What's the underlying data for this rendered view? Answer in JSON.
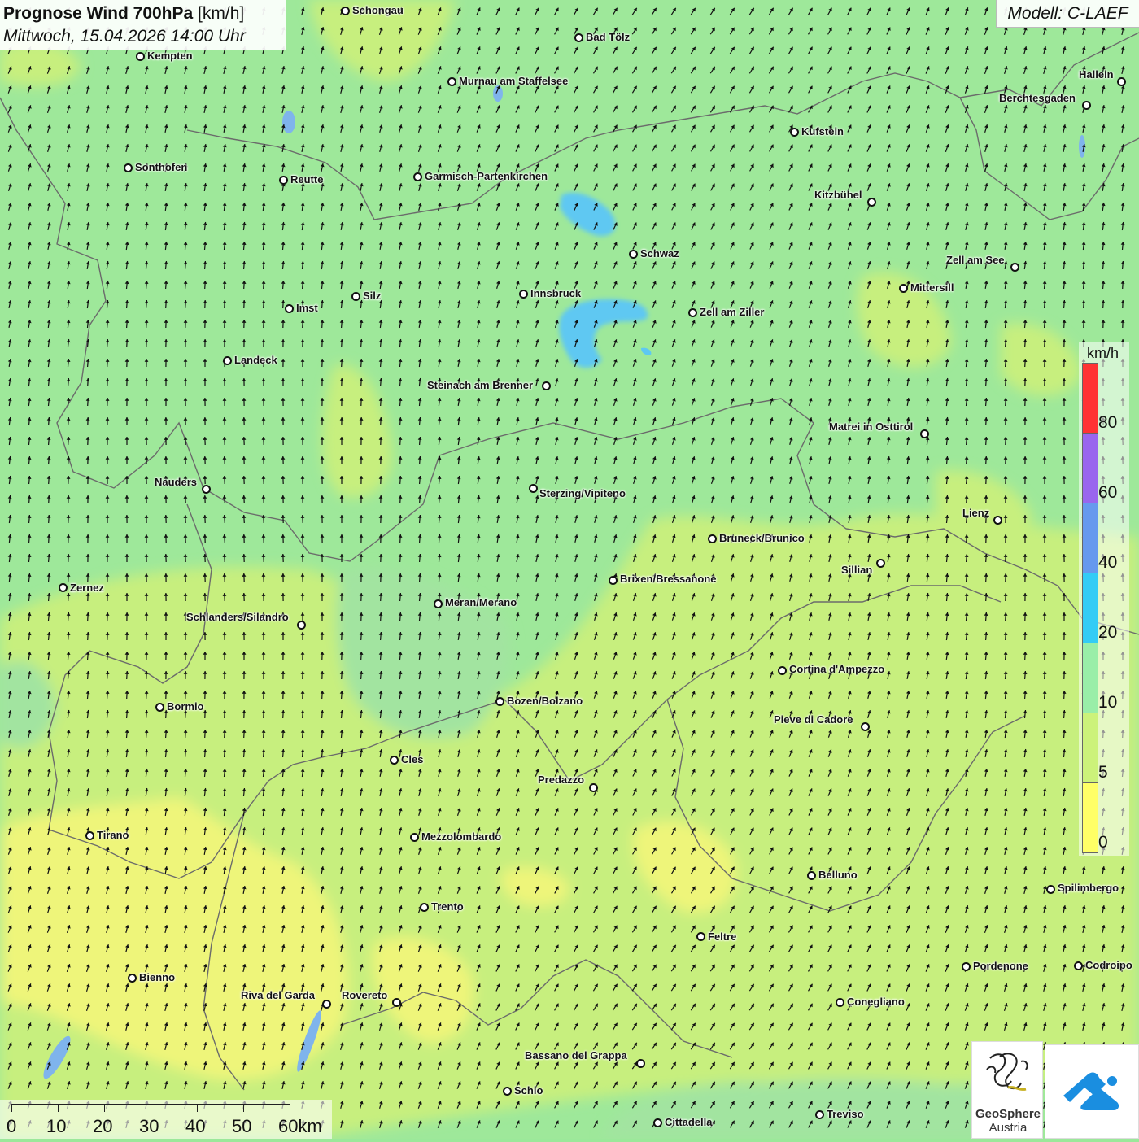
{
  "header": {
    "title": "Prognose Wind 700hPa",
    "title_unit": "[km/h]",
    "datetime": "Mittwoch, 15.04.2026 14:00 Uhr",
    "model": "Modell: C-LAEF"
  },
  "legend": {
    "unit": "km/h",
    "classes": [
      {
        "color": "#ff3333",
        "label": ""
      },
      {
        "color": "#9966ee",
        "label": "80"
      },
      {
        "color": "#6699ee",
        "label": "60"
      },
      {
        "color": "#33ccf5",
        "label": "40"
      },
      {
        "color": "#99eea8",
        "label": "20"
      },
      {
        "color": "#ccf27a",
        "label": "10"
      },
      {
        "color": "#ffff66",
        "label": "5"
      }
    ],
    "bottom_label": "0"
  },
  "scale_bar": {
    "labels": [
      "0",
      "10",
      "20",
      "30",
      "40",
      "50",
      "60km"
    ]
  },
  "wind": {
    "general_direction": "south-southwest",
    "max_speed_class": "20-40 km/h near Innsbruck"
  },
  "cities": [
    {
      "name": "Schongau"
    },
    {
      "name": "Bad Tölz"
    },
    {
      "name": "Kempten"
    },
    {
      "name": "Murnau am Staffelsee"
    },
    {
      "name": "Hallein"
    },
    {
      "name": "Berchtesgaden"
    },
    {
      "name": "Kufstein"
    },
    {
      "name": "Sonthofen"
    },
    {
      "name": "Reutte"
    },
    {
      "name": "Garmisch-Partenkirchen"
    },
    {
      "name": "Kitzbühel"
    },
    {
      "name": "Schwaz"
    },
    {
      "name": "Zell am See"
    },
    {
      "name": "Mittersill"
    },
    {
      "name": "Innsbruck"
    },
    {
      "name": "Silz"
    },
    {
      "name": "Imst"
    },
    {
      "name": "Zell am Ziller"
    },
    {
      "name": "Landeck"
    },
    {
      "name": "Steinach am Brenner"
    },
    {
      "name": "Matrei in Osttirol"
    },
    {
      "name": "Nauders"
    },
    {
      "name": "Sterzing/Vipiteno"
    },
    {
      "name": "Lienz"
    },
    {
      "name": "Bruneck/Brunico"
    },
    {
      "name": "Sillian"
    },
    {
      "name": "Zernez"
    },
    {
      "name": "Brixen/Bressanone"
    },
    {
      "name": "Meran/Merano"
    },
    {
      "name": "Schlanders/Silandro"
    },
    {
      "name": "Cortina d'Ampezzo"
    },
    {
      "name": "Bozen/Bolzano"
    },
    {
      "name": "Bormio"
    },
    {
      "name": "Pieve di Cadore"
    },
    {
      "name": "Cles"
    },
    {
      "name": "Predazzo"
    },
    {
      "name": "Tirano"
    },
    {
      "name": "Mezzolombardo"
    },
    {
      "name": "Belluno"
    },
    {
      "name": "Spilimbergo"
    },
    {
      "name": "Trento"
    },
    {
      "name": "Feltre"
    },
    {
      "name": "Pordenone"
    },
    {
      "name": "Codroipo"
    },
    {
      "name": "Bienno"
    },
    {
      "name": "Riva del Garda"
    },
    {
      "name": "Rovereto"
    },
    {
      "name": "Conegliano"
    },
    {
      "name": "Bassano del Grappa"
    },
    {
      "name": "Schio"
    },
    {
      "name": "Treviso"
    },
    {
      "name": "Cittadella"
    }
  ],
  "logos": {
    "geosphere_line1": "GeoSphere",
    "geosphere_line2": "Austria"
  }
}
